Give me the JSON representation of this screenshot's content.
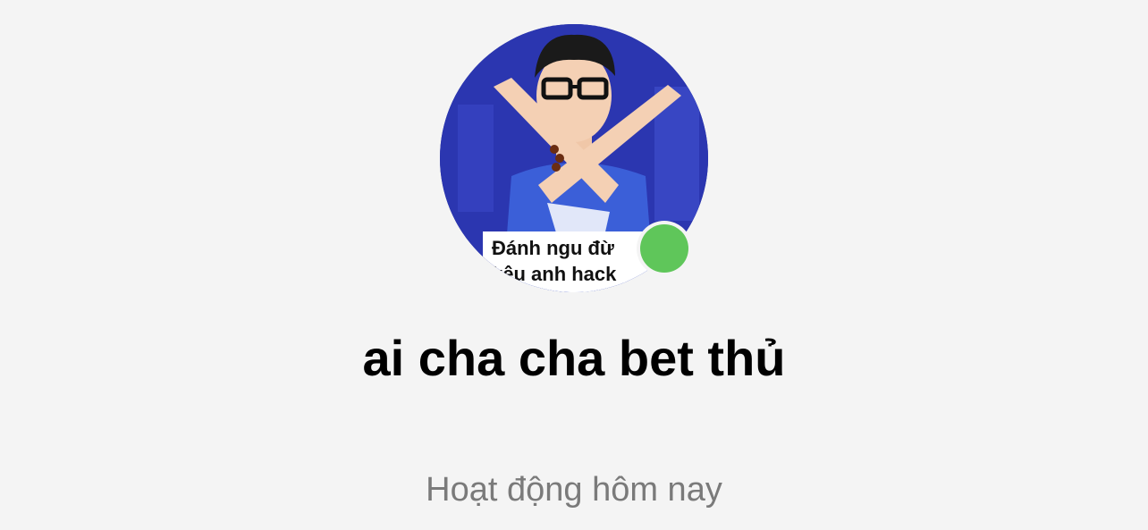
{
  "profile": {
    "name": "ai cha cha bet thủ",
    "status_text": "Hoạt động hôm nay",
    "online": true,
    "avatar_caption_line1": "Đánh ngu đừ",
    "avatar_caption_line2": "kêu anh hack",
    "presence_color": "#5fc65a"
  }
}
